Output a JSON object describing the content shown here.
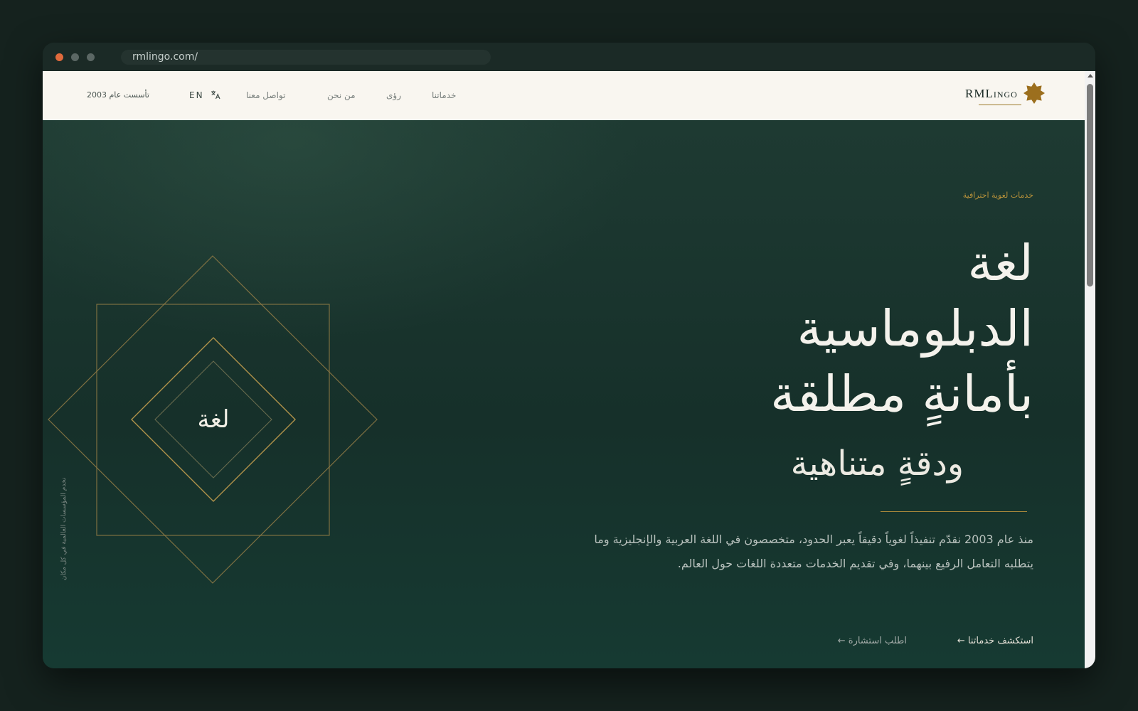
{
  "browser": {
    "url": "rmlingo.com/"
  },
  "navbar": {
    "logo": {
      "main": "RML",
      "small": "INGO"
    },
    "links": [
      {
        "label": "خدماتنا"
      },
      {
        "label": "رؤى"
      },
      {
        "label": "من نحن"
      },
      {
        "label": "تواصل معنا"
      }
    ],
    "language": "EN",
    "founded": "تأسست عام 2003"
  },
  "hero": {
    "eyebrow": "خدمات لغوية احترافية",
    "headline": [
      "لغة",
      "الدبلوماسية",
      "بأمانةٍ مطلقة"
    ],
    "subline": "ودقةٍ متناهية",
    "paragraph": "منذ عام 2003 نقدّم تنفيذاً لغوياً دقيقاً يعبر الحدود، متخصصون في اللغة العربية والإنجليزية وما يتطلبه التعامل الرفيع بينهما، وفي تقديم الخدمات متعددة اللغات حول العالم.",
    "cta_primary": "استكشف خدماتنا ←",
    "cta_secondary": "اطلب استشارة ←",
    "emblem_text": "لغة",
    "vertical_text": "نخدم المؤسسات العالمية في كل مكان"
  },
  "colors": {
    "accent_gold": "#b8923a",
    "hero_green": "#16302a",
    "navbar_bg": "#f9f6f0",
    "close_dot": "#e06a3c"
  },
  "icons": {
    "logo": "eight-point-star-icon",
    "language": "translate-icon"
  }
}
